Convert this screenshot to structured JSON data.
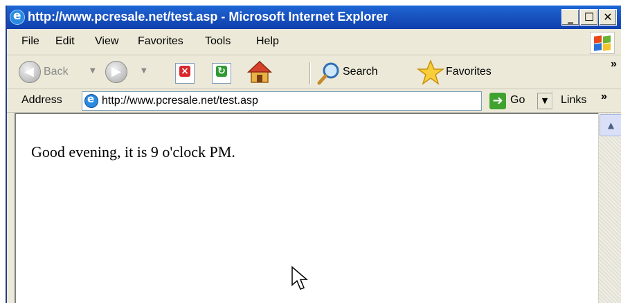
{
  "window": {
    "title": "http://www.pcresale.net/test.asp - Microsoft Internet Explorer",
    "controls": [
      "minimize",
      "maximize",
      "close"
    ]
  },
  "menubar": {
    "items": [
      "File",
      "Edit",
      "View",
      "Favorites",
      "Tools",
      "Help"
    ]
  },
  "toolbar": {
    "back_label": "Back",
    "search_label": "Search",
    "favorites_label": "Favorites",
    "chevron": "»"
  },
  "addressbar": {
    "label": "Address",
    "url": "http://www.pcresale.net/test.asp",
    "go_label": "Go",
    "links_label": "Links",
    "chevron": "»"
  },
  "page": {
    "text": "Good evening, it is 9 o'clock PM."
  },
  "colors": {
    "titlebar": "#1954c0",
    "chrome": "#ece9d8",
    "go_green": "#3fa22f"
  }
}
